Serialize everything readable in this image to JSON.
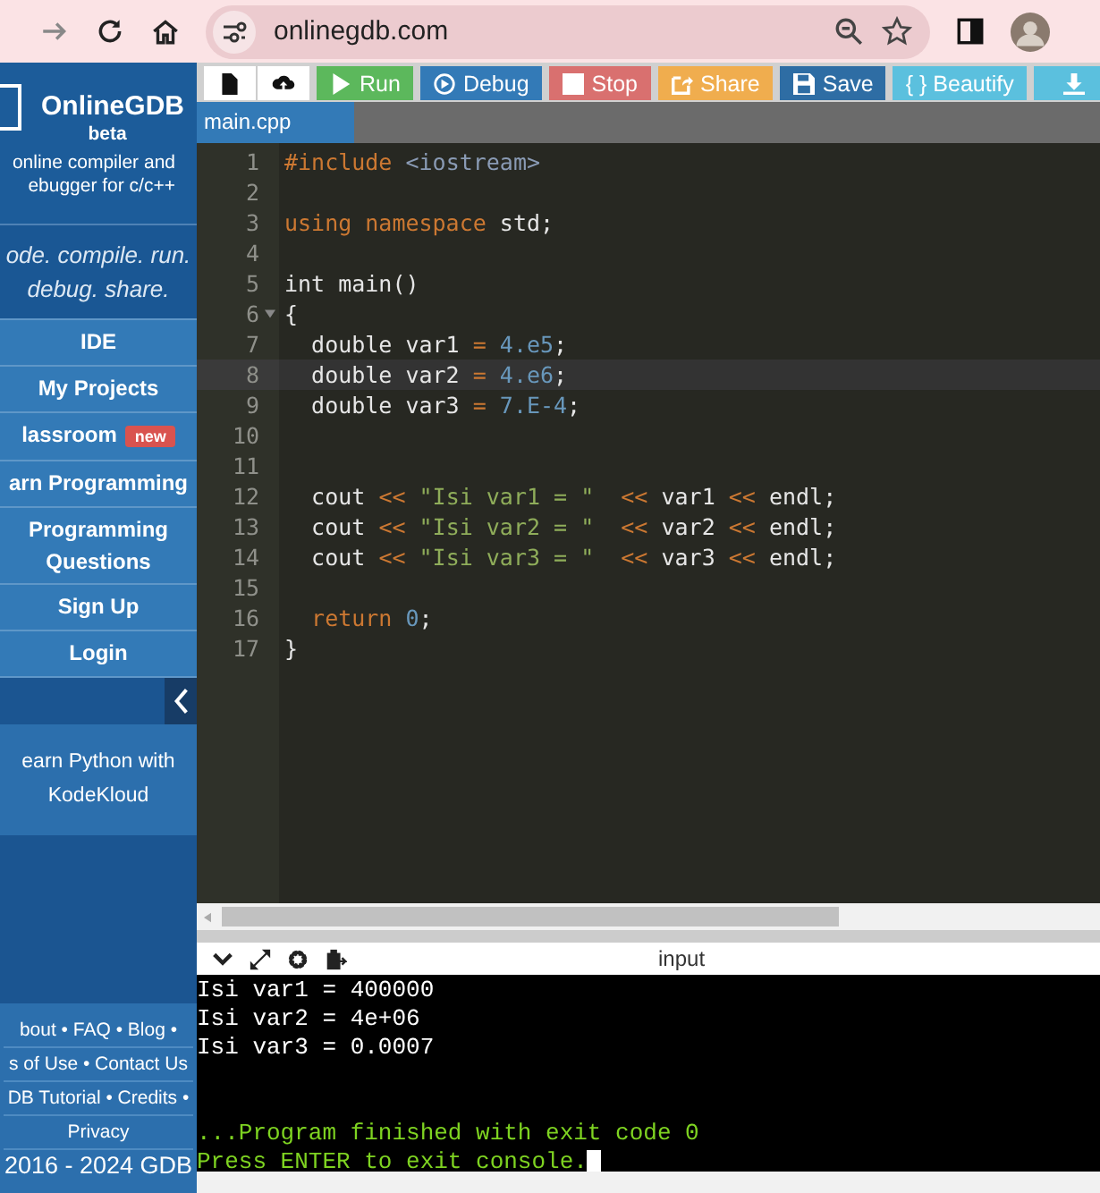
{
  "browser": {
    "url": "onlinegdb.com"
  },
  "sidebar": {
    "brand": "OnlineGDB",
    "badge": "beta",
    "subtitle": [
      "online compiler and",
      "ebugger for c/c++"
    ],
    "tagline": [
      "ode. compile. run.",
      "debug. share."
    ],
    "menu": [
      {
        "label": "IDE"
      },
      {
        "label": "My Projects"
      },
      {
        "label": "lassroom",
        "tag": "new"
      },
      {
        "label": "arn Programming"
      },
      {
        "label": "Programming Questions"
      },
      {
        "label": "Sign Up"
      },
      {
        "label": "Login"
      }
    ],
    "promo": [
      "earn Python with",
      "KodeKloud"
    ],
    "footer": [
      "bout • FAQ • Blog •",
      "s of Use • Contact Us",
      "DB Tutorial • Credits •",
      "Privacy",
      "2016 - 2024 GDB"
    ]
  },
  "toolbar": [
    {
      "kind": "new",
      "color": "#ffffff"
    },
    {
      "kind": "upload",
      "color": "#ffffff"
    },
    {
      "kind": "play",
      "label": "Run",
      "color": "#5cb85c"
    },
    {
      "kind": "debug",
      "label": "Debug",
      "color": "#337ab7"
    },
    {
      "kind": "stop",
      "label": "Stop",
      "color": "#d9706f"
    },
    {
      "kind": "share",
      "label": "Share",
      "color": "#f0ad4e"
    },
    {
      "kind": "save",
      "label": "Save",
      "color": "#2e6da4"
    },
    {
      "kind": "beautify",
      "label": "{ } Beautify",
      "color": "#5bc0de"
    },
    {
      "kind": "download",
      "color": "#5bc0de"
    }
  ],
  "tabs": [
    {
      "label": "main.cpp",
      "selected": true
    }
  ],
  "editor": {
    "lines": [
      {
        "n": "1",
        "tokens": [
          {
            "t": "#include",
            "kind": "pp"
          },
          {
            "t": " <iostream>",
            "kind": "hdr"
          }
        ]
      },
      {
        "n": "2"
      },
      {
        "n": "3",
        "tokens": [
          {
            "t": "using namespace",
            "kind": "kw"
          },
          {
            "t": " std;",
            "kind": "id"
          }
        ]
      },
      {
        "n": "4"
      },
      {
        "n": "5",
        "tokens": [
          {
            "t": "int main()",
            "kind": "id"
          }
        ]
      },
      {
        "n": "6",
        "foldable": true,
        "tokens": [
          {
            "t": "{",
            "kind": "id"
          }
        ]
      },
      {
        "n": "7",
        "tokens": [
          {
            "t": "  double var1 ",
            "kind": "id"
          },
          {
            "t": "=",
            "kind": "op"
          },
          {
            "t": " 4.e5",
            "kind": "num"
          },
          {
            "t": ";",
            "kind": "id"
          }
        ]
      },
      {
        "n": "8",
        "active": true,
        "tokens": [
          {
            "t": "  double var2 ",
            "kind": "id"
          },
          {
            "t": "=",
            "kind": "op"
          },
          {
            "t": " 4.e6",
            "kind": "num"
          },
          {
            "t": ";",
            "kind": "id"
          }
        ]
      },
      {
        "n": "9",
        "tokens": [
          {
            "t": "  double var3 ",
            "kind": "id"
          },
          {
            "t": "=",
            "kind": "op"
          },
          {
            "t": " 7.E-4",
            "kind": "num"
          },
          {
            "t": ";",
            "kind": "id"
          }
        ]
      },
      {
        "n": "10"
      },
      {
        "n": "11"
      },
      {
        "n": "12",
        "tokens": [
          {
            "t": "  cout ",
            "kind": "id"
          },
          {
            "t": "<<",
            "kind": "op"
          },
          {
            "t": " \"Isi var1 = \"",
            "kind": "str"
          },
          {
            "t": "  <<",
            "kind": "op"
          },
          {
            "t": " var1 ",
            "kind": "id"
          },
          {
            "t": "<<",
            "kind": "op"
          },
          {
            "t": " endl;",
            "kind": "id"
          }
        ]
      },
      {
        "n": "13",
        "tokens": [
          {
            "t": "  cout ",
            "kind": "id"
          },
          {
            "t": "<<",
            "kind": "op"
          },
          {
            "t": " \"Isi var2 = \"",
            "kind": "str"
          },
          {
            "t": "  <<",
            "kind": "op"
          },
          {
            "t": " var2 ",
            "kind": "id"
          },
          {
            "t": "<<",
            "kind": "op"
          },
          {
            "t": " endl;",
            "kind": "id"
          }
        ]
      },
      {
        "n": "14",
        "tokens": [
          {
            "t": "  cout ",
            "kind": "id"
          },
          {
            "t": "<<",
            "kind": "op"
          },
          {
            "t": " \"Isi var3 = \"",
            "kind": "str"
          },
          {
            "t": "  <<",
            "kind": "op"
          },
          {
            "t": " var3 ",
            "kind": "id"
          },
          {
            "t": "<<",
            "kind": "op"
          },
          {
            "t": " endl;",
            "kind": "id"
          }
        ]
      },
      {
        "n": "15"
      },
      {
        "n": "16",
        "tokens": [
          {
            "t": "  return",
            "kind": "kw"
          },
          {
            "t": " 0",
            "kind": "num"
          },
          {
            "t": ";",
            "kind": "id"
          }
        ]
      },
      {
        "n": "17",
        "tokens": [
          {
            "t": "}",
            "kind": "id"
          }
        ]
      }
    ]
  },
  "console": {
    "title": "input",
    "lines": [
      {
        "kind": "out",
        "text": "Isi var1 = 400000"
      },
      {
        "kind": "out",
        "text": "Isi var2 = 4e+06"
      },
      {
        "kind": "out",
        "text": "Isi var3 = 0.0007"
      },
      {
        "kind": "blank"
      },
      {
        "kind": "blank"
      },
      {
        "kind": "status",
        "text": "...Program finished with exit code 0"
      },
      {
        "kind": "status",
        "text": "Press ENTER to exit console.",
        "cursor": true
      }
    ]
  }
}
